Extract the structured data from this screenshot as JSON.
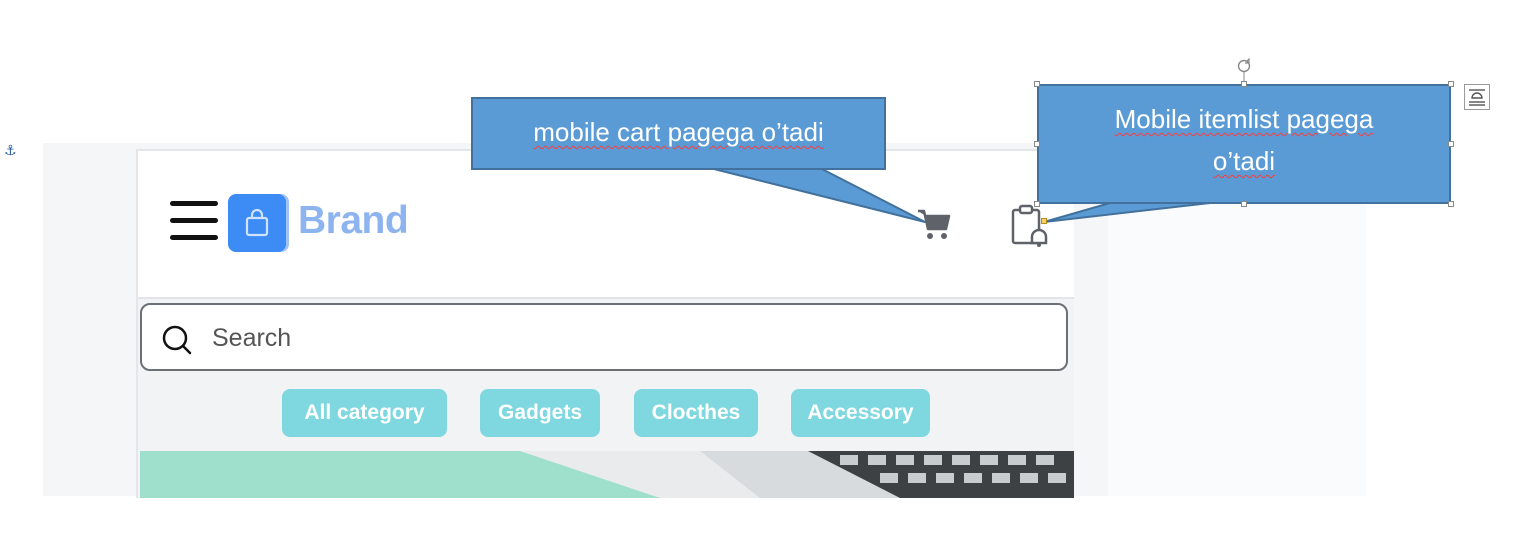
{
  "header": {
    "brand": "Brand",
    "menu_icon": "hamburger-icon",
    "logo_icon": "shopping-bag-icon",
    "cart_icon": "cart-icon",
    "itemlist_icon": "clipboard-bell-icon",
    "brand_color": "#8db4ee",
    "logo_color": "#3d8bf5"
  },
  "search": {
    "placeholder": "Search",
    "value": "",
    "icon": "search-icon"
  },
  "categories": [
    {
      "label": "All category"
    },
    {
      "label": "Gadgets"
    },
    {
      "label": "Clocthes"
    },
    {
      "label": "Accessory"
    }
  ],
  "chip_color": "#7fd8df",
  "callouts": {
    "cart": "mobile  cart pagega o’tadi",
    "itemlist_line1": "Mobile  itemlist pagega",
    "itemlist_line2": "o’tadi",
    "fill_color": "#5b9bd5"
  },
  "anchor_icon": "anchor-icon",
  "rotate_icon": "rotate-handle-icon",
  "layout_options_icon": "text-wrap-icon"
}
